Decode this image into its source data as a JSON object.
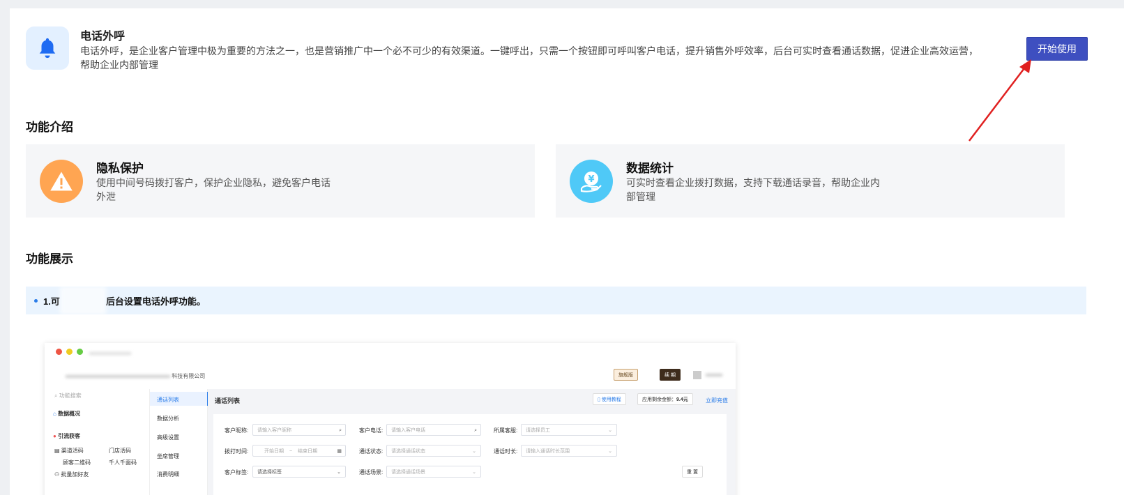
{
  "app": {
    "title": "电话外呼",
    "description": "电话外呼，是企业客户管理中极为重要的方法之一，也是营销推广中一个必不可少的有效渠道。一键呼出，只需一个按钮即可呼叫客户电话，提升销售外呼效率，后台可实时查看通话数据，促进企业高效运营，帮助企业内部管理",
    "start_button": "开始使用"
  },
  "features_section": {
    "title": "功能介绍",
    "items": [
      {
        "title": "隐私保护",
        "desc": "使用中间号码拨打客户，保护企业隐私，避免客户电话外泄",
        "color": "#ffa552"
      },
      {
        "title": "数据统计",
        "desc": "可实时查看企业拨打数据，支持下载通话录音，帮助企业内部管理",
        "color": "#4fc9f7"
      }
    ]
  },
  "showcase_section": {
    "title": "功能展示",
    "step1_left": "1.可",
    "step1_right": "后台设置电话外呼功能。"
  },
  "screenshot": {
    "company": "科技有限公司",
    "badge_flagship": "旗舰版",
    "badge_renew": "续 期",
    "sidebar_search": "功能搜索",
    "sidebar": [
      "数据概况",
      "引流获客",
      "渠道活码",
      "门店活码",
      "顾客二维码",
      "千人千面码",
      "批量加好友"
    ],
    "subnav": [
      "通话列表",
      "数据分析",
      "高级设置",
      "坐席管理",
      "消费明细"
    ],
    "main_title": "通话列表",
    "tutorial": "使用教程",
    "balance_label": "应用剩余金额：",
    "balance_value": "9.4元",
    "recharge": "立即充值",
    "filters": {
      "nickname_label": "客户昵称:",
      "nickname_ph": "请输入客户昵称",
      "phone_label": "客户电话:",
      "phone_ph": "请输入客户电话",
      "staff_label": "所属客服:",
      "staff_ph": "请选择员工",
      "time_label": "拨打时间:",
      "start_ph": "开始日期",
      "tilde": "~",
      "end_ph": "结束日期",
      "status_label": "通话状态:",
      "status_ph": "请选择通话状态",
      "duration_label": "通话时长:",
      "duration_ph": "请输入通话时长范围",
      "tag_label": "客户标签:",
      "tag_ph": "请选择标签",
      "scene_label": "通话场景:",
      "scene_ph": "请选择通话场景",
      "reset": "重 置"
    }
  }
}
